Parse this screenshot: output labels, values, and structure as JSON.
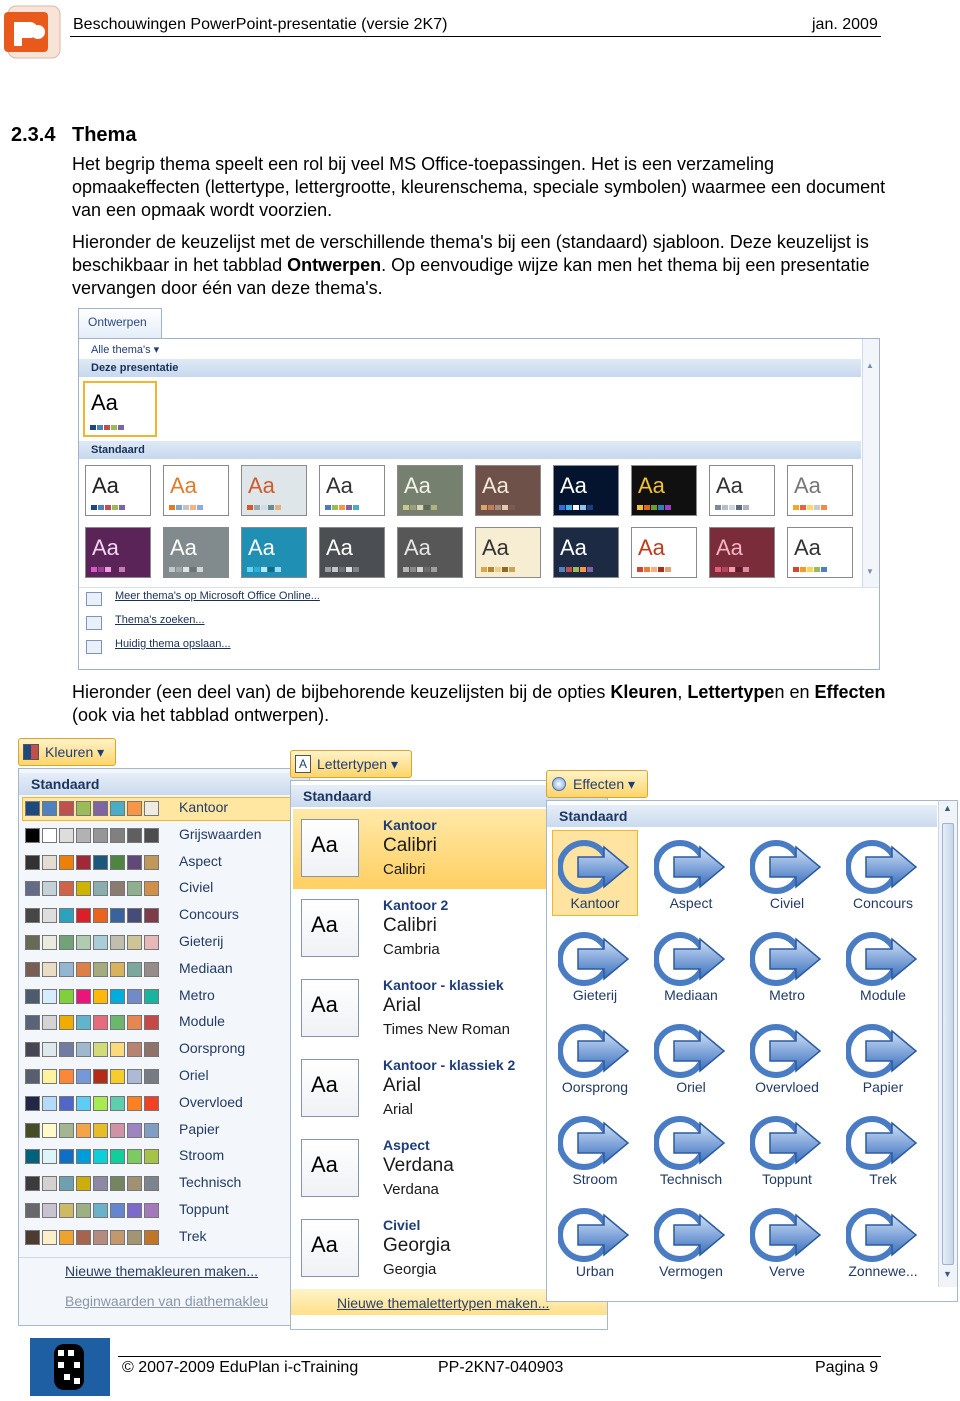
{
  "header": {
    "title": "Beschouwingen PowerPoint-presentatie (versie 2K7)",
    "date": "jan. 2009"
  },
  "section": {
    "number": "2.3.4",
    "title": "Thema"
  },
  "paragraphs": {
    "p1": "Het begrip thema speelt een rol bij veel MS Office-toepassingen. Het is een verzameling opmaakeffecten (lettertype, lettergrootte, kleurenschema, speciale symbolen) waarmee een document van een opmaak wordt voorzien.",
    "p2_a": "Hieronder de keuzelijst met de verschillende thema's bij een (standaard) sjabloon. Deze keuzelijst is beschikbaar in het tabblad ",
    "p2_b": "Ontwerpen",
    "p2_c": ". Op eenvoudige wijze kan men het thema bij een presentatie vervangen door één van deze thema's.",
    "p3_a": "Hieronder (een deel van) de bijbehorende keuzelijsten bij de opties ",
    "p3_b": "Kleuren",
    "p3_c": ", ",
    "p3_d": "Lettertype",
    "p3_e": "n en ",
    "p3_f": "Effecten",
    "p3_g": " (ook via het tabblad ontwerpen)."
  },
  "theme_gallery": {
    "tab": "Ontwerpen",
    "all_themes": "Alle thema's ▾",
    "this_presentation": "Deze presentatie",
    "standard": "Standaard",
    "current_label": "Aa",
    "thumb_label": "Aa",
    "thumbs": [
      {
        "bg": "#ffffff",
        "fg": "#222222",
        "bars": [
          "#1f497d",
          "#4f81bd",
          "#c0504d",
          "#9bbb59",
          "#8064a2"
        ]
      },
      {
        "bg": "#ffffff",
        "fg": "#e07b2a",
        "bars": [
          "#e07b2a",
          "#7fa7c9",
          "#c3c3c3",
          "#f4b183",
          "#8faadc"
        ]
      },
      {
        "bg": "#dfe6ea",
        "fg": "#d05a2a",
        "bars": [
          "#d05a2a",
          "#9aa7ad",
          "#ccdde4",
          "#6b8a99",
          "#e2b07a"
        ]
      },
      {
        "bg": "#ffffff",
        "fg": "#333333",
        "bars": [
          "#4a7ebb",
          "#9bbb59",
          "#f79646",
          "#8064a2",
          "#4bacc6"
        ]
      },
      {
        "bg": "#76806f",
        "fg": "#f2f2e8",
        "bars": [
          "#c9c78a",
          "#9aa07f",
          "#dcd6b2",
          "#5f6a55",
          "#b4b27a"
        ]
      },
      {
        "bg": "#6e5249",
        "fg": "#f4e8dc",
        "bars": [
          "#d9a36f",
          "#c47b5a",
          "#a88f7c",
          "#e6c9a8",
          "#7d5a4f"
        ]
      },
      {
        "bg": "#05142e",
        "fg": "#ffffff",
        "bars": [
          "#2a6fdb",
          "#3fb0e8",
          "#ffffff",
          "#8cc3f0",
          "#1a3f80"
        ]
      },
      {
        "bg": "#101010",
        "fg": "#f2c233",
        "bars": [
          "#f2c233",
          "#e06a1c",
          "#6f9d2a",
          "#2f7fbf",
          "#9a3fbf"
        ]
      },
      {
        "bg": "#ffffff",
        "fg": "#333333",
        "bars": [
          "#7d8a99",
          "#b3bfcc",
          "#d0d7e0",
          "#5b6a7a",
          "#a8b4c2"
        ]
      },
      {
        "bg": "#ffffff",
        "fg": "#777777",
        "bars": [
          "#f5a623",
          "#e8624a",
          "#ffd86a",
          "#c9c9c9",
          "#f08a4b"
        ]
      },
      {
        "bg": "#5a2458",
        "fg": "#f3d6f1",
        "bars": [
          "#d957c8",
          "#9b3f93",
          "#f29be6",
          "#5b2257",
          "#c47ab9"
        ]
      },
      {
        "bg": "#818a8c",
        "fg": "#ffffff",
        "bars": [
          "#c3c9cb",
          "#a0a8aa",
          "#e0e4e5",
          "#6b7375",
          "#d3d7d8"
        ]
      },
      {
        "bg": "#1f8fb4",
        "fg": "#ffffff",
        "bars": [
          "#6fd1f0",
          "#2bb0d9",
          "#b7e8f6",
          "#0d6c8a",
          "#9bdcf0"
        ]
      },
      {
        "bg": "#4b4e52",
        "fg": "#ffffff",
        "bars": [
          "#9aa0a6",
          "#c3c7cb",
          "#6d7176",
          "#e0e2e4",
          "#80858a"
        ]
      },
      {
        "bg": "#575757",
        "fg": "#e6e6e6",
        "bars": [
          "#b6b6b6",
          "#8a8a8a",
          "#d4d4d4",
          "#6b6b6b",
          "#a0a0a0"
        ]
      },
      {
        "bg": "#f7edd2",
        "fg": "#333333",
        "bars": [
          "#d6a84a",
          "#b38531",
          "#e8cf8f",
          "#8f6a22",
          "#c9a55c"
        ]
      },
      {
        "bg": "#1c2a44",
        "fg": "#ffffff",
        "bars": [
          "#4f81bd",
          "#c0504d",
          "#9bbb59",
          "#f79646",
          "#8064a2"
        ]
      },
      {
        "bg": "#ffffff",
        "fg": "#c0391b",
        "bars": [
          "#d0462c",
          "#f07a3a",
          "#f4b183",
          "#a82f1a",
          "#e6a07a"
        ]
      },
      {
        "bg": "#7b2c3a",
        "fg": "#f5b4c2",
        "bars": [
          "#e05f7a",
          "#b3455e",
          "#f29ab0",
          "#5e1c2a",
          "#d98ca0"
        ]
      },
      {
        "bg": "#ffffff",
        "fg": "#333333",
        "bars": [
          "#d9442c",
          "#f39a2d",
          "#ffd34d",
          "#9bbb59",
          "#4f81bd"
        ]
      }
    ],
    "menu": {
      "more": "Meer thema's op Microsoft Office Online...",
      "search": "Thema's zoeken...",
      "save": "Huidig thema opslaan..."
    }
  },
  "kleuren": {
    "button": "Kleuren ▾",
    "header": "Standaard",
    "items": [
      {
        "name": "Kantoor",
        "colors": [
          "#1f497d",
          "#4f81bd",
          "#c0504d",
          "#9bbb59",
          "#8064a2",
          "#4bacc6",
          "#f79646",
          "#eeece1"
        ]
      },
      {
        "name": "Grijswaarden",
        "colors": [
          "#000000",
          "#ffffff",
          "#dddddd",
          "#b2b2b2",
          "#969696",
          "#808080",
          "#5f5f5f",
          "#4d4d4d"
        ]
      },
      {
        "name": "Aspect",
        "colors": [
          "#323232",
          "#e3ded1",
          "#f07f09",
          "#9f2936",
          "#1b587c",
          "#4e8542",
          "#604878",
          "#c19859"
        ]
      },
      {
        "name": "Civiel",
        "colors": [
          "#646b86",
          "#c5d1d7",
          "#d16349",
          "#ccb400",
          "#8cadae",
          "#8c7b70",
          "#8fb08c",
          "#d19049"
        ]
      },
      {
        "name": "Concours",
        "colors": [
          "#464646",
          "#dedede",
          "#2da2bf",
          "#da1f28",
          "#eb641b",
          "#39639d",
          "#474b78",
          "#7d3c4a"
        ]
      },
      {
        "name": "Gieterij",
        "colors": [
          "#676a55",
          "#eaebde",
          "#72a376",
          "#b0ccb0",
          "#a8cdd7",
          "#c0beaf",
          "#cec597",
          "#e8b7b7"
        ]
      },
      {
        "name": "Mediaan",
        "colors": [
          "#775f55",
          "#ebddc3",
          "#94b6d2",
          "#dd8047",
          "#a5ab81",
          "#d8b25c",
          "#7ba79d",
          "#968c8c"
        ]
      },
      {
        "name": "Metro",
        "colors": [
          "#4e5b6f",
          "#d6ecff",
          "#7fd13b",
          "#ea157a",
          "#feb80a",
          "#00addc",
          "#738ac8",
          "#1ab39f"
        ]
      },
      {
        "name": "Module",
        "colors": [
          "#5a6378",
          "#d4d4d4",
          "#f0ad00",
          "#60b5cc",
          "#e66c7d",
          "#6bb76d",
          "#e88651",
          "#c64847"
        ]
      },
      {
        "name": "Oorsprong",
        "colors": [
          "#464653",
          "#dde9ec",
          "#727ca3",
          "#9fb8cd",
          "#d2da7a",
          "#fada7a",
          "#b88472",
          "#8e736a"
        ]
      },
      {
        "name": "Oriel",
        "colors": [
          "#575f6d",
          "#fff39d",
          "#fe8637",
          "#7598d9",
          "#b32c16",
          "#f5cd2d",
          "#aebad5",
          "#777c84"
        ]
      },
      {
        "name": "Overvloed",
        "colors": [
          "#212745",
          "#b4dcfa",
          "#4e67c8",
          "#5eccf3",
          "#a7ea52",
          "#5dceaf",
          "#ff8021",
          "#f14124"
        ]
      },
      {
        "name": "Papier",
        "colors": [
          "#444d26",
          "#fefac9",
          "#a5b592",
          "#f3a447",
          "#e7bc29",
          "#d092a7",
          "#9c85c0",
          "#809ec2"
        ]
      },
      {
        "name": "Stroom",
        "colors": [
          "#04617b",
          "#dbf5f9",
          "#0f6fc6",
          "#009dd9",
          "#0bd0d9",
          "#10cf9b",
          "#7cca62",
          "#a5c249"
        ]
      },
      {
        "name": "Technisch",
        "colors": [
          "#3b3b3b",
          "#d4d2d0",
          "#6ea0b0",
          "#ccaf0a",
          "#8d89a4",
          "#748560",
          "#9e9273",
          "#7e848d"
        ]
      },
      {
        "name": "Toppunt",
        "colors": [
          "#69676d",
          "#c9c2d1",
          "#ceb966",
          "#9cb084",
          "#6bb1c9",
          "#6585cf",
          "#7e6bc9",
          "#a379bb"
        ]
      },
      {
        "name": "Trek",
        "colors": [
          "#4e3b30",
          "#fbeec9",
          "#f0a22e",
          "#a5644e",
          "#b58b80",
          "#c3986d",
          "#a19574",
          "#c17529"
        ]
      }
    ],
    "new": "Nieuwe themakleuren maken...",
    "reset": "Beginwaarden van diathemakleu"
  },
  "lettertypen": {
    "button": "Lettertypen ▾",
    "header": "Standaard",
    "box_label": "Aa",
    "items": [
      {
        "name": "Kantoor",
        "heading": "Calibri",
        "body": "Calibri"
      },
      {
        "name": "Kantoor 2",
        "heading": "Calibri",
        "body": "Cambria"
      },
      {
        "name": "Kantoor - klassiek",
        "heading": "Arial",
        "body": "Times New Roman"
      },
      {
        "name": "Kantoor - klassiek 2",
        "heading": "Arial",
        "body": "Arial"
      },
      {
        "name": "Aspect",
        "heading": "Verdana",
        "body": "Verdana"
      },
      {
        "name": "Civiel",
        "heading": "Georgia",
        "body": "Georgia"
      }
    ],
    "new": "Nieuwe themalettertypen maken..."
  },
  "effecten": {
    "button": "Effecten ▾",
    "header": "Standaard",
    "items": [
      "Kantoor",
      "Aspect",
      "Civiel",
      "Concours",
      "Gieterij",
      "Mediaan",
      "Metro",
      "Module",
      "Oorsprong",
      "Oriel",
      "Overvloed",
      "Papier",
      "Stroom",
      "Technisch",
      "Toppunt",
      "Trek",
      "Urban",
      "Vermogen",
      "Verve",
      "Zonnewe..."
    ]
  },
  "footer": {
    "copyright": "© 2007-2009  EduPlan i-cTraining",
    "code": "PP-2KN7-040903",
    "page": "Pagina 9"
  },
  "colors": {
    "accent": "#ffd56a",
    "ui_border": "#9fb4cc",
    "link": "#1a2f55"
  }
}
